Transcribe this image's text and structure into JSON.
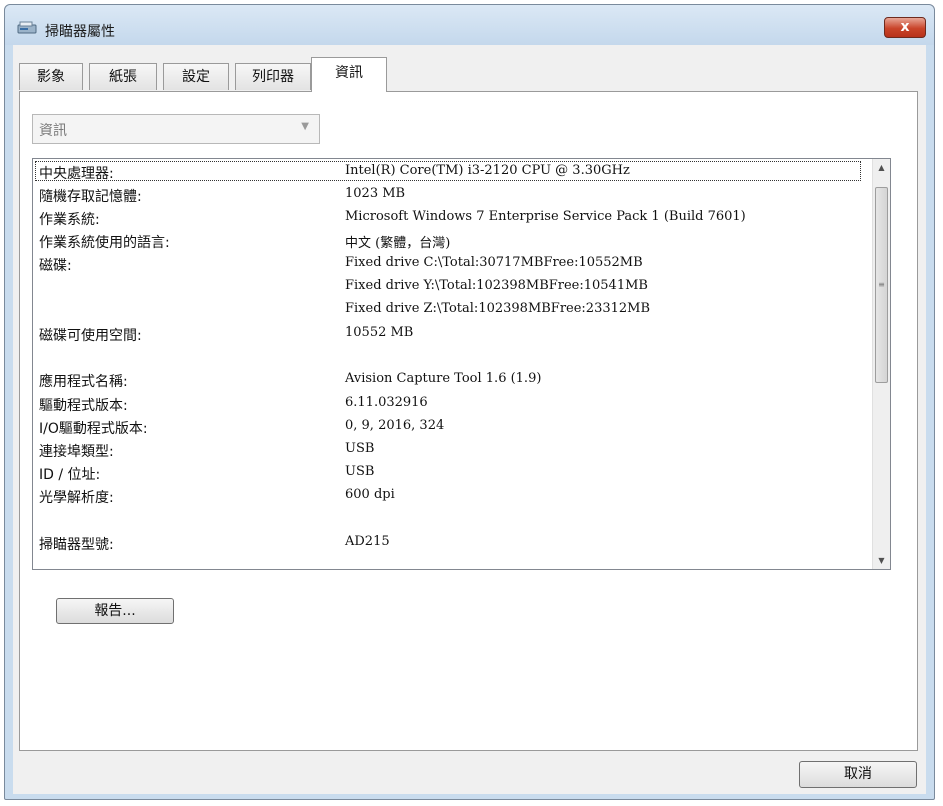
{
  "window": {
    "title": "掃瞄器屬性",
    "icon": "scanner-icon",
    "close_glyph": "x"
  },
  "tabs": [
    {
      "label": "影象"
    },
    {
      "label": "紙張"
    },
    {
      "label": "設定"
    },
    {
      "label": "列印器"
    },
    {
      "label": "資訊",
      "active": true
    }
  ],
  "combo": {
    "value": "資訊",
    "arrow": "▼"
  },
  "info": {
    "rows": [
      {
        "key": "中央處理器:",
        "value": "Intel(R) Core(TM) i3-2120 CPU @ 3.30GHz"
      },
      {
        "key": "隨機存取記憶體:",
        "value": "1023 MB"
      },
      {
        "key": "作業系統:",
        "value": "Microsoft Windows 7 Enterprise Service Pack 1 (Build 7601)"
      },
      {
        "key": "作業系統使用的語言:",
        "value": "中文 (繁體，台灣)"
      },
      {
        "key": "磁碟:",
        "value": "Fixed drive C:\\Total:30717MBFree:10552MB"
      },
      {
        "key": "",
        "value": "Fixed drive Y:\\Total:102398MBFree:10541MB"
      },
      {
        "key": "",
        "value": "Fixed drive Z:\\Total:102398MBFree:23312MB"
      },
      {
        "key": "磁碟可使用空間:",
        "value": "10552 MB"
      },
      {
        "key": "應用程式名稱:",
        "value": "Avision Capture Tool 1.6 (1.9)"
      },
      {
        "key": "驅動程式版本:",
        "value": "6.11.032916"
      },
      {
        "key": "I/O驅動程式版本:",
        "value": "0, 9, 2016, 324"
      },
      {
        "key": "連接埠類型:",
        "value": "USB"
      },
      {
        "key": "ID / 位址:",
        "value": "USB"
      },
      {
        "key": "光學解析度:",
        "value": "600 dpi"
      },
      {
        "key": "掃瞄器型號:",
        "value": "AD215"
      }
    ]
  },
  "scrollbar": {
    "up": "▲",
    "down": "▼",
    "grip": "≡"
  },
  "buttons": {
    "report": "報告...",
    "cancel": "取消"
  }
}
